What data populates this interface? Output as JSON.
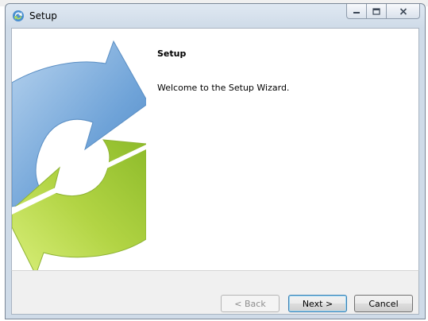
{
  "window": {
    "title": "Setup",
    "app_icon": "setup-refresh-icon"
  },
  "caption": {
    "minimize_icon": "minimize-icon",
    "maximize_icon": "maximize-icon",
    "close_icon": "close-icon"
  },
  "main": {
    "heading": "Setup",
    "welcome_text": "Welcome to the Setup Wizard.",
    "artwork_icon": "circular-arrows-icon"
  },
  "buttons": {
    "back_label": "< Back",
    "next_label": "Next >",
    "cancel_label": "Cancel"
  },
  "colors": {
    "arrow_blue": "#6fa3d8",
    "arrow_green": "#a8cc3a"
  }
}
